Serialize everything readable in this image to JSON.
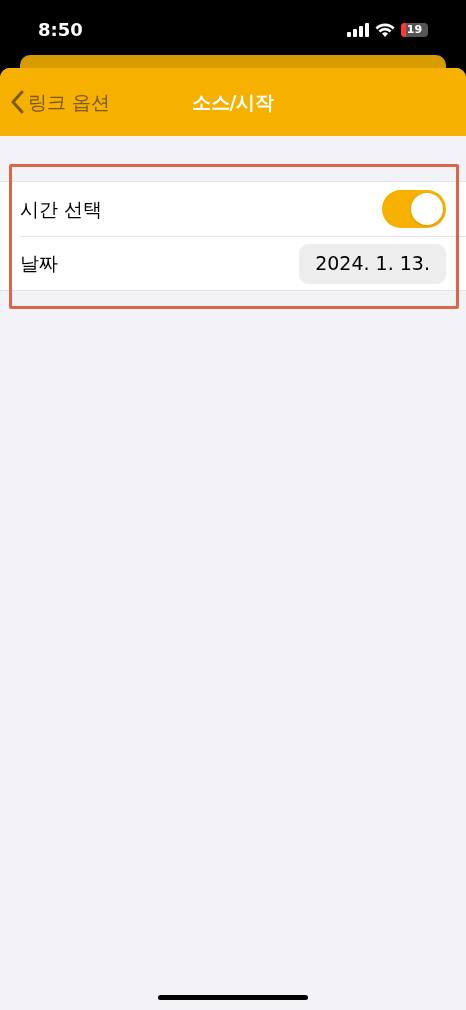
{
  "status_bar": {
    "time": "8:50",
    "battery": "19"
  },
  "nav": {
    "back": "링크 옵션",
    "title": "소스/시작"
  },
  "rows": [
    {
      "kind": "toggle",
      "label": "시간 선택",
      "on": true
    },
    {
      "kind": "date",
      "label": "날짜",
      "value": "2024. 1. 13."
    }
  ]
}
